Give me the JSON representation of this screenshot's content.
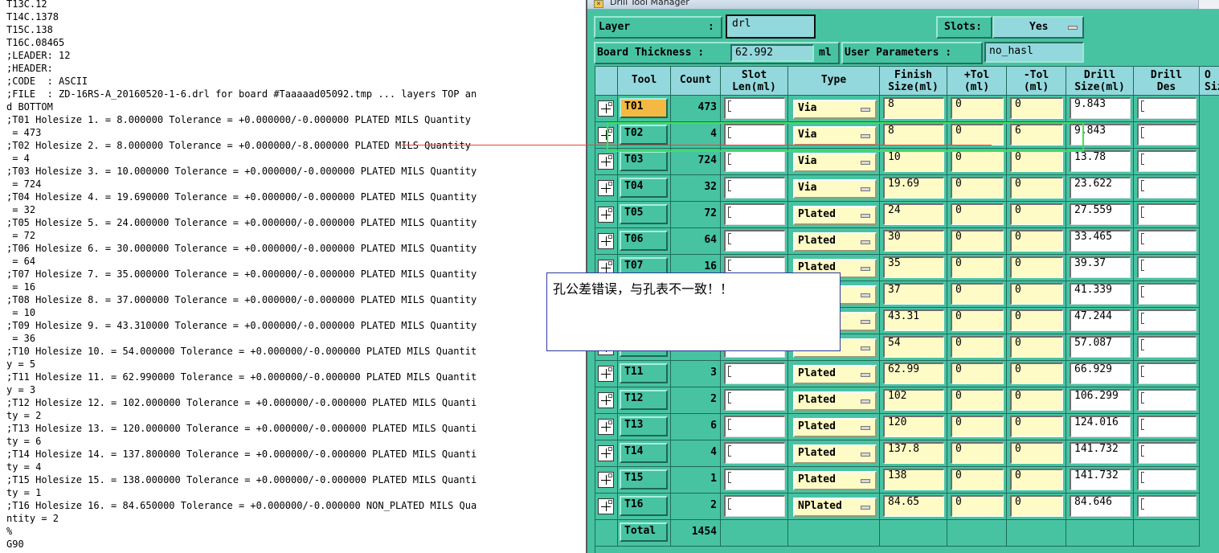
{
  "log": {
    "lines": [
      "T13C.12",
      "T14C.1378",
      "T15C.138",
      "T16C.08465",
      ";LEADER: 12",
      ";HEADER:",
      ";CODE  : ASCII",
      ";FILE  : ZD-16RS-A_20160520-1-6.drl for board #Taaaaad05092.tmp ... layers TOP an",
      "d BOTTOM",
      ";T01 Holesize 1. = 8.000000 Tolerance = +0.000000/-0.000000 PLATED MILS Quantity",
      " = 473",
      ";T02 Holesize 2. = 8.000000 Tolerance = +0.000000/-8.000000 PLATED MILS Quantity",
      " = 4",
      ";T03 Holesize 3. = 10.000000 Tolerance = +0.000000/-0.000000 PLATED MILS Quantity",
      " = 724",
      ";T04 Holesize 4. = 19.690000 Tolerance = +0.000000/-0.000000 PLATED MILS Quantity",
      " = 32",
      ";T05 Holesize 5. = 24.000000 Tolerance = +0.000000/-0.000000 PLATED MILS Quantity",
      " = 72",
      ";T06 Holesize 6. = 30.000000 Tolerance = +0.000000/-0.000000 PLATED MILS Quantity",
      " = 64",
      ";T07 Holesize 7. = 35.000000 Tolerance = +0.000000/-0.000000 PLATED MILS Quantity",
      " = 16",
      ";T08 Holesize 8. = 37.000000 Tolerance = +0.000000/-0.000000 PLATED MILS Quantity",
      " = 10",
      ";T09 Holesize 9. = 43.310000 Tolerance = +0.000000/-0.000000 PLATED MILS Quantity",
      " = 36",
      ";T10 Holesize 10. = 54.000000 Tolerance = +0.000000/-0.000000 PLATED MILS Quantit",
      "y = 5",
      ";T11 Holesize 11. = 62.990000 Tolerance = +0.000000/-0.000000 PLATED MILS Quantit",
      "y = 3",
      ";T12 Holesize 12. = 102.000000 Tolerance = +0.000000/-0.000000 PLATED MILS Quanti",
      "ty = 2",
      ";T13 Holesize 13. = 120.000000 Tolerance = +0.000000/-0.000000 PLATED MILS Quanti",
      "ty = 6",
      ";T14 Holesize 14. = 137.800000 Tolerance = +0.000000/-0.000000 PLATED MILS Quanti",
      "ty = 4",
      ";T15 Holesize 15. = 138.000000 Tolerance = +0.000000/-0.000000 PLATED MILS Quanti",
      "ty = 1",
      ";T16 Holesize 16. = 84.650000 Tolerance = +0.000000/-0.000000 NON_PLATED MILS Qua",
      "ntity = 2",
      "%",
      "G90"
    ]
  },
  "window": {
    "title": "Drill Tool Manager",
    "layer_label": "Layer",
    "layer_colon": ":",
    "layer_value": "drl",
    "slots_label": "Slots:",
    "slots_value": "Yes",
    "board_thickness_label": "Board Thickness :",
    "board_thickness_value": "62.992",
    "board_thickness_unit": "ml",
    "user_params_label": "User Parameters :",
    "user_params_value": "no_hasl"
  },
  "table": {
    "headers": {
      "tool": "Tool",
      "count": "Count",
      "slot_len": "Slot Len(ml)",
      "type": "Type",
      "finish_size": "Finish Size(ml)",
      "plus_tol": "+Tol (ml)",
      "minus_tol": "-Tol (ml)",
      "drill_size": "Drill Size(ml)",
      "drill_des": "Drill Des",
      "extra": "O Siz"
    },
    "rows": [
      {
        "tool": "T01",
        "count": "473",
        "type": "Via",
        "finish": "8",
        "ptol": "0",
        "mtol": "0",
        "drill": "9.843"
      },
      {
        "tool": "T02",
        "count": "4",
        "type": "Via",
        "finish": "8",
        "ptol": "0",
        "mtol": "6",
        "drill": "9.843"
      },
      {
        "tool": "T03",
        "count": "724",
        "type": "Via",
        "finish": "10",
        "ptol": "0",
        "mtol": "0",
        "drill": "13.78"
      },
      {
        "tool": "T04",
        "count": "32",
        "type": "Via",
        "finish": "19.69",
        "ptol": "0",
        "mtol": "0",
        "drill": "23.622"
      },
      {
        "tool": "T05",
        "count": "72",
        "type": "Plated",
        "finish": "24",
        "ptol": "0",
        "mtol": "0",
        "drill": "27.559"
      },
      {
        "tool": "T06",
        "count": "64",
        "type": "Plated",
        "finish": "30",
        "ptol": "0",
        "mtol": "0",
        "drill": "33.465"
      },
      {
        "tool": "T07",
        "count": "16",
        "type": "Plated",
        "finish": "35",
        "ptol": "0",
        "mtol": "0",
        "drill": "39.37"
      },
      {
        "tool": "",
        "count": "",
        "type": "",
        "finish": "37",
        "ptol": "0",
        "mtol": "0",
        "drill": "41.339"
      },
      {
        "tool": "",
        "count": "",
        "type": "",
        "finish": "43.31",
        "ptol": "0",
        "mtol": "0",
        "drill": "47.244"
      },
      {
        "tool": "",
        "count": "",
        "type": "",
        "finish": "54",
        "ptol": "0",
        "mtol": "0",
        "drill": "57.087"
      },
      {
        "tool": "T11",
        "count": "3",
        "type": "Plated",
        "finish": "62.99",
        "ptol": "0",
        "mtol": "0",
        "drill": "66.929"
      },
      {
        "tool": "T12",
        "count": "2",
        "type": "Plated",
        "finish": "102",
        "ptol": "0",
        "mtol": "0",
        "drill": "106.299"
      },
      {
        "tool": "T13",
        "count": "6",
        "type": "Plated",
        "finish": "120",
        "ptol": "0",
        "mtol": "0",
        "drill": "124.016"
      },
      {
        "tool": "T14",
        "count": "4",
        "type": "Plated",
        "finish": "137.8",
        "ptol": "0",
        "mtol": "0",
        "drill": "141.732"
      },
      {
        "tool": "T15",
        "count": "1",
        "type": "Plated",
        "finish": "138",
        "ptol": "0",
        "mtol": "0",
        "drill": "141.732"
      },
      {
        "tool": "T16",
        "count": "2",
        "type": "NPlated",
        "finish": "84.65",
        "ptol": "0",
        "mtol": "0",
        "drill": "84.646"
      }
    ],
    "total_label": "Total",
    "total_value": "1454"
  },
  "annotation": {
    "text": "孔公差错误，与孔表不一致！！",
    "highlight_color": "#3ce25a",
    "line_color": "#e8433b"
  },
  "colors": {
    "window_bg": "#47c3a2",
    "header_bg": "#93d8dd",
    "cell_yellow": "#fefbc6",
    "selected_tool": "#f4b942"
  }
}
